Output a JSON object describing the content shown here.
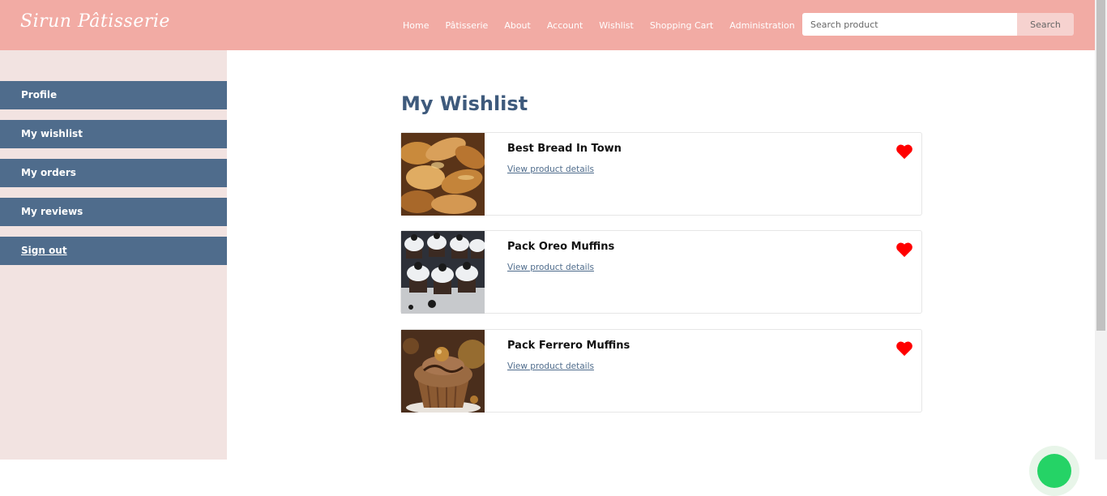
{
  "brand": {
    "name": "Sirun Pâtisserie"
  },
  "nav": {
    "items": [
      "Home",
      "Pâtisserie",
      "About",
      "Account",
      "Wishlist",
      "Shopping Cart",
      "Administration"
    ]
  },
  "search": {
    "placeholder": "Search product",
    "button_label": "Search"
  },
  "sidebar": {
    "items": [
      {
        "label": "Profile"
      },
      {
        "label": "My wishlist"
      },
      {
        "label": "My orders"
      },
      {
        "label": "My reviews"
      },
      {
        "label": "Sign out"
      }
    ]
  },
  "main": {
    "title": "My Wishlist",
    "products": [
      {
        "name": "Best Bread In Town",
        "link_label": "View product details",
        "image": "bread-photo"
      },
      {
        "name": "Pack Oreo Muffins",
        "link_label": "View product details",
        "image": "oreo-muffins-photo"
      },
      {
        "name": "Pack Ferrero Muffins",
        "link_label": "View product details",
        "image": "ferrero-muffin-photo"
      }
    ]
  },
  "colors": {
    "navbar": "#f2aba4",
    "sidebar_bg": "#f2e3e1",
    "sidebar_item": "#4f6c8c",
    "title": "#3e5a7c",
    "heart": "#ff0000",
    "chat": "#25d366"
  },
  "icons": {
    "wishlist": "heart-icon",
    "chat": "whatsapp-chat-icon"
  }
}
